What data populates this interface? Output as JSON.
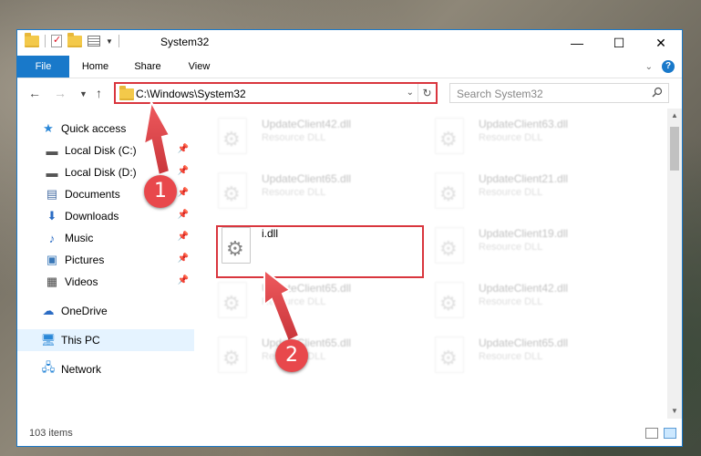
{
  "window": {
    "title": "System32"
  },
  "ribbon": {
    "tabs": [
      "File",
      "Home",
      "Share",
      "View"
    ]
  },
  "nav": {
    "address": "C:\\Windows\\System32",
    "search_placeholder": "Search System32"
  },
  "sidebar": {
    "items": [
      {
        "label": "Quick access",
        "icon": "star-icon"
      },
      {
        "label": "Local Disk (C:)",
        "icon": "drive-icon"
      },
      {
        "label": "Local Disk (D:)",
        "icon": "drive-icon"
      },
      {
        "label": "Documents",
        "icon": "documents-icon"
      },
      {
        "label": "Downloads",
        "icon": "download-icon"
      },
      {
        "label": "Music",
        "icon": "music-icon"
      },
      {
        "label": "Pictures",
        "icon": "pictures-icon"
      },
      {
        "label": "Videos",
        "icon": "videos-icon"
      },
      {
        "label": "OneDrive",
        "icon": "cloud-icon"
      },
      {
        "label": "This PC",
        "icon": "computer-icon"
      },
      {
        "label": "Network",
        "icon": "network-icon"
      }
    ]
  },
  "files": [
    {
      "name": "UpdateClient42.dll",
      "type": "Resource DLL"
    },
    {
      "name": "UpdateClient63.dll",
      "type": "Resource DLL"
    },
    {
      "name": "UpdateClient65.dll",
      "type": "Resource DLL"
    },
    {
      "name": "UpdateClient21.dll",
      "type": "Resource DLL"
    },
    {
      "name": "i.dll",
      "type": ""
    },
    {
      "name": "UpdateClient19.dll",
      "type": "Resource DLL"
    },
    {
      "name": "UpdateClient65.dll",
      "type": "Resource DLL"
    },
    {
      "name": "UpdateClient42.dll",
      "type": "Resource DLL"
    },
    {
      "name": "UpdateClient65.dll",
      "type": "Resource DLL"
    },
    {
      "name": "UpdateClient65.dll",
      "type": "Resource DLL"
    }
  ],
  "status": {
    "item_count": "103 items"
  },
  "annotations": {
    "step1": "1",
    "step2": "2"
  },
  "colors": {
    "accent": "#1979ca",
    "highlight": "#d9363e",
    "badge": "#e8484c"
  }
}
